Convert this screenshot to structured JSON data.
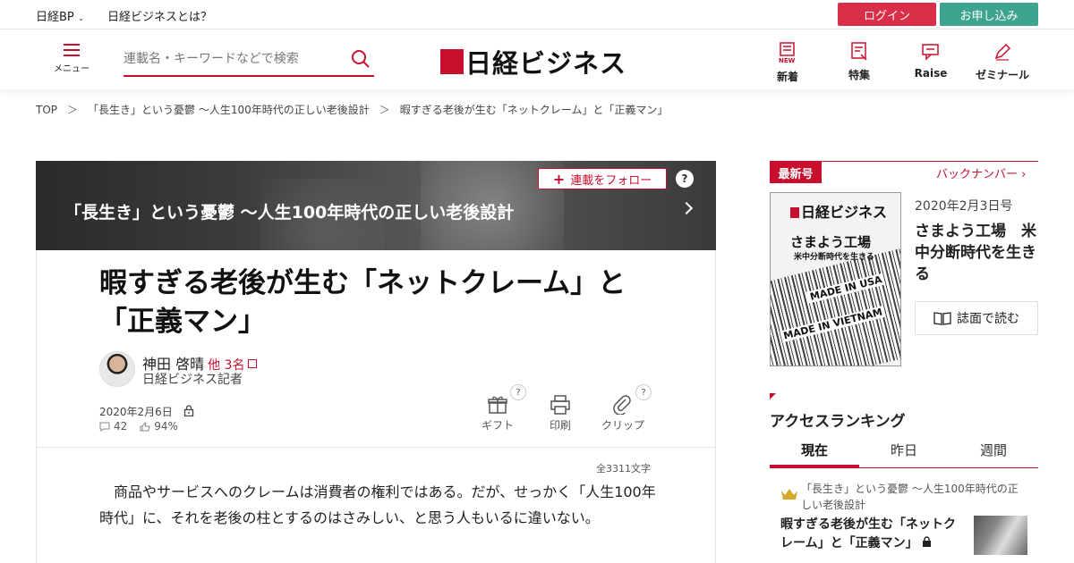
{
  "topbar": {
    "nikkeibp": "日経BP",
    "about": "日経ビジネスとは？",
    "login": "ログイン",
    "apply": "お申し込み",
    "login_color": "#d92e47",
    "apply_color": "#3ea38f"
  },
  "header": {
    "menu_label": "メニュー",
    "search_placeholder": "連載名・キーワードなどで検索",
    "logo": "日経ビジネス",
    "nav": [
      {
        "label": "新着",
        "icon": "new-icon"
      },
      {
        "label": "特集",
        "icon": "feature-icon"
      },
      {
        "label": "Raise",
        "icon": "raise-icon"
      },
      {
        "label": "ゼミナール",
        "icon": "pen-icon"
      }
    ]
  },
  "breadcrumb": {
    "items": [
      "TOP",
      "「長生き」という憂鬱 ～人生100年時代の正しい老後設計",
      "暇すぎる老後が生む「ネットクレーム」と「正義マン」"
    ],
    "separator": "＞"
  },
  "series": {
    "title": "「長生き」という憂鬱 ～人生100年時代の正しい老後設計",
    "follow_label": "連載をフォロー",
    "help": "?"
  },
  "article": {
    "title": "暇すぎる老後が生む「ネットクレーム」と「正義マン」",
    "author_name": "神田 啓晴",
    "author_others": "他 3名",
    "author_role": "日経ビジネス記者",
    "date": "2020年2月6日",
    "comments": "42",
    "likes": "94%",
    "tools": {
      "gift": "ギフト",
      "print": "印刷",
      "clip": "クリップ",
      "help": "?"
    },
    "char_count": "全3311文字",
    "body": "商品やサービスへのクレームは消費者の権利ではある。だが、せっかく「人生100年時代」に、それを老後の柱とするのはさみしい、と思う人もいるに違いない。"
  },
  "sidebar": {
    "latest_label": "最新号",
    "backnumber": "バックナンバー",
    "cover": {
      "logo": "日経ビジネス",
      "title": "さまよう工場",
      "subtitle": "米中分断時代を生きる",
      "made1": "MADE IN USA",
      "made2": "MADE IN VIETNAM"
    },
    "issue_date": "2020年2月3日号",
    "issue_title": "さまよう工場　米中分断時代を生きる",
    "read_label": "誌面で読む",
    "ranking_title": "アクセスランキング",
    "tabs": [
      "現在",
      "昨日",
      "週間"
    ],
    "rank_item": {
      "series": "「長生き」という憂鬱 ～人生100年時代の正しい老後設計",
      "title": "暇すぎる老後が生む「ネットクレーム」と「正義マン」"
    }
  }
}
